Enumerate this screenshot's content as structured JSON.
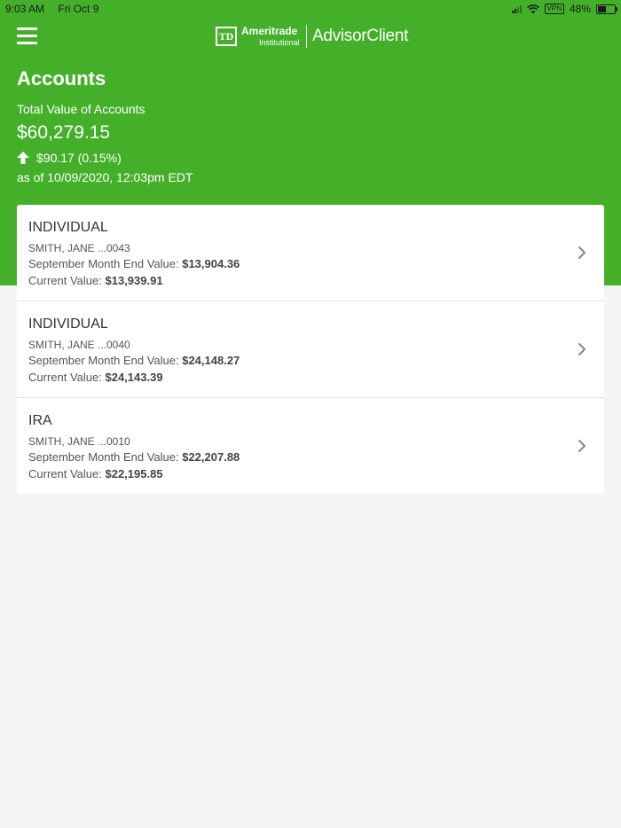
{
  "status": {
    "time": "9:03 AM",
    "date": "Fri Oct 9",
    "vpn": "VPN",
    "battery": "48%",
    "battery_level": 0.48
  },
  "brand": {
    "td": "TD",
    "name": "Ameritrade",
    "sub": "Institutional",
    "product": "AdvisorClient",
    "color": "#44b02a"
  },
  "summary": {
    "title": "Accounts",
    "total_label": "Total Value of Accounts",
    "total_value": "$60,279.15",
    "change": "$90.17 (0.15%)",
    "as_of": "as of 10/09/2020, 12:03pm EDT"
  },
  "accounts": [
    {
      "type": "INDIVIDUAL",
      "name": "SMITH, JANE ...0043",
      "month_end_label": "September Month End Value:",
      "month_end_value": "$13,904.36",
      "current_label": "Current Value:",
      "current_value": "$13,939.91"
    },
    {
      "type": "INDIVIDUAL",
      "name": "SMITH, JANE ...0040",
      "month_end_label": "September Month End Value:",
      "month_end_value": "$24,148.27",
      "current_label": "Current Value:",
      "current_value": "$24,143.39"
    },
    {
      "type": "IRA",
      "name": "SMITH, JANE ...0010",
      "month_end_label": "September Month End Value:",
      "month_end_value": "$22,207.88",
      "current_label": "Current Value:",
      "current_value": "$22,195.85"
    }
  ]
}
